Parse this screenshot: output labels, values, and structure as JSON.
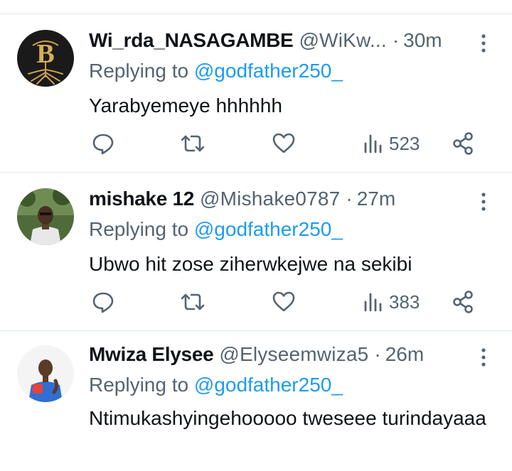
{
  "tweets": [
    {
      "name": "Wi_rda_NASAGAMBE",
      "handle": "@WiKw...",
      "separator": "·",
      "time": "30m",
      "replying_prefix": "Replying to ",
      "replying_to": "@godfather250_",
      "text": "Yarabyemeye hhhhhh",
      "views": "523",
      "avatar": "gold-tree-logo"
    },
    {
      "name": "mishake 12",
      "handle": "@Mishake0787",
      "separator": "·",
      "time": "27m",
      "replying_prefix": "Replying to ",
      "replying_to": "@godfather250_",
      "text": "Ubwo hit zose ziherwkejwe na sekibi",
      "views": "383",
      "avatar": "man-outdoors-photo"
    },
    {
      "name": "Mwiza Elysee",
      "handle": "@Elyseemwiza5",
      "separator": "·",
      "time": "26m",
      "replying_prefix": "Replying to ",
      "replying_to": "@godfather250_",
      "text": "Ntimukashyingehooooo tweseee turindayaaa",
      "avatar": "person-blue-shirt-photo"
    }
  ],
  "colors": {
    "text": "#0f1419",
    "secondary": "#536471",
    "link": "#1d9bf0",
    "divider": "#e1e8ed"
  }
}
